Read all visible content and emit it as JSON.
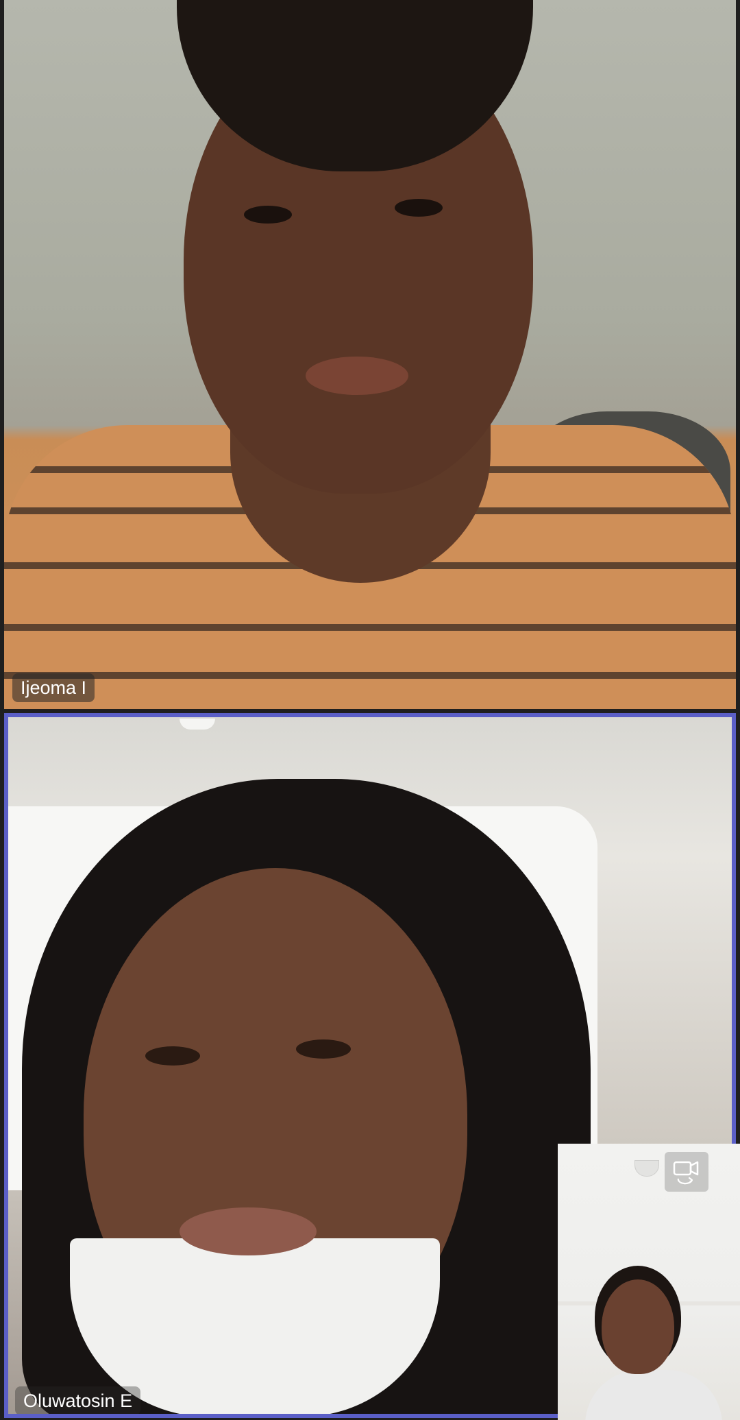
{
  "participants": [
    {
      "name": "Ijeoma I",
      "active_speaker": false
    },
    {
      "name": "Oluwatosin E",
      "active_speaker": true
    }
  ],
  "self_view": {
    "switch_camera_icon": "switch-camera-icon"
  },
  "colors": {
    "active_speaker_border": "#5b5fc7",
    "name_tag_bg": "rgba(40,40,40,0.55)",
    "name_tag_text": "#ffffff"
  }
}
